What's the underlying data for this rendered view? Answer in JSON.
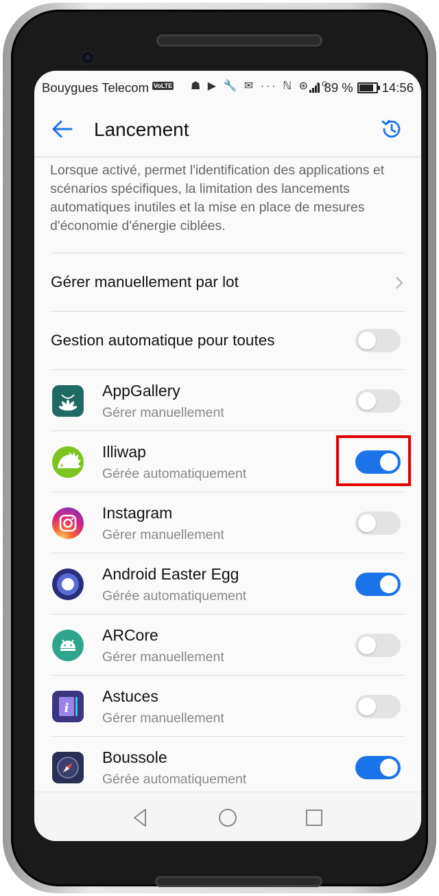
{
  "status_bar": {
    "carrier": "Bouygues Telecom",
    "volte_badge": "VoLTE",
    "notification_icons": "☗ ▶ 🔧 ✉ ··· ℕ ⊛ ⁴ᴳ",
    "battery_percent": "89 %",
    "time": "14:56"
  },
  "app_bar": {
    "title": "Lancement",
    "back_icon": "arrow-left",
    "history_icon": "history-clock"
  },
  "description": "Lorsque activé, permet l'identification des applications et scénarios spécifiques, la limitation des lancements automatiques inutiles et la mise en place de mesures d'économie d'énergie ciblées.",
  "manage_batch": {
    "label": "Gérer manuellement par lot"
  },
  "auto_all": {
    "label": "Gestion automatique pour toutes",
    "enabled": false
  },
  "apps": [
    {
      "name": "AppGallery",
      "status": "Gérer manuellement",
      "enabled": false,
      "icon": "huawei-appgallery-icon"
    },
    {
      "name": "Illiwap",
      "status": "Gérée automatiquement",
      "enabled": true,
      "icon": "illiwap-hedgehog-icon"
    },
    {
      "name": "Instagram",
      "status": "Gérer manuellement",
      "enabled": false,
      "icon": "instagram-icon"
    },
    {
      "name": "Android Easter Egg",
      "status": "Gérée automatiquement",
      "enabled": true,
      "icon": "easter-egg-icon"
    },
    {
      "name": "ARCore",
      "status": "Gérer manuellement",
      "enabled": false,
      "icon": "arcore-android-icon"
    },
    {
      "name": "Astuces",
      "status": "Gérer manuellement",
      "enabled": false,
      "icon": "astuces-tips-icon"
    },
    {
      "name": "Boussole",
      "status": "Gérée automatiquement",
      "enabled": true,
      "icon": "compass-icon"
    }
  ],
  "colors": {
    "accent": "#1a73e8",
    "highlight": "#e00000"
  }
}
